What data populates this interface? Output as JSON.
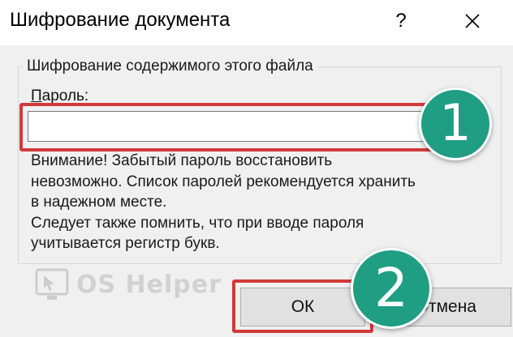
{
  "dialog": {
    "title": "Шифрование документа",
    "help_label": "?",
    "close_icon": "close-icon"
  },
  "group": {
    "caption": "Шифрование содержимого этого файла",
    "password_label_mnemonic": "П",
    "password_label_rest": "ароль:",
    "password_value": "",
    "warning_lines": [
      "Внимание! Забытый пароль восстановить",
      "невозможно. Список паролей рекомендуется хранить",
      "в надежном месте.",
      "Следует также помнить, что при вводе пароля",
      "учитывается регистр букв."
    ]
  },
  "buttons": {
    "ok_label": "ОК",
    "cancel_label": "Отмена"
  },
  "annotations": {
    "step1_number": "1",
    "step2_number": "2",
    "highlight_color": "#d23a3a",
    "badge_color": "#1f9e84"
  },
  "watermark": {
    "text": "OS Helper",
    "icon": "cursor-monitor-icon"
  }
}
